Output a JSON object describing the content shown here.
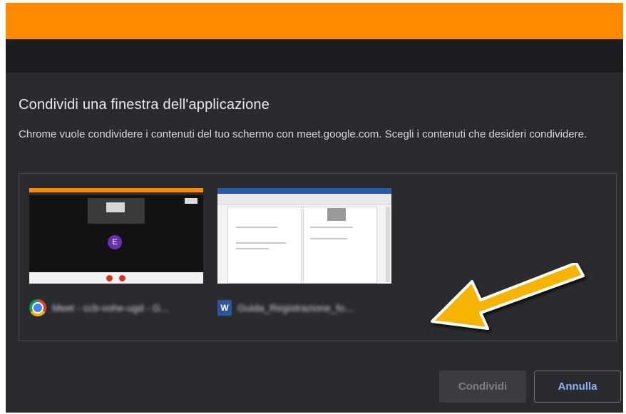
{
  "dialog": {
    "title": "Condividi una finestra dell'applicazione",
    "message": "Chrome vuole condividere i contenuti del tuo schermo con meet.google.com. Scegli i contenuti che desideri condividere."
  },
  "windows": [
    {
      "icon": "chrome-icon",
      "label": "Meet - ccb-vohe-ugd - G...",
      "avatar_letter": "E"
    },
    {
      "icon": "word-icon",
      "icon_letter": "W",
      "label": "Guida_Registrazione_fo..."
    }
  ],
  "buttons": {
    "share": "Condividi",
    "cancel": "Annulla"
  },
  "colors": {
    "top_bar": "#ff8a00",
    "dialog_bg": "#2a2b2f",
    "cancel_text": "#8ab4f8",
    "arrow": "#f5b400"
  }
}
